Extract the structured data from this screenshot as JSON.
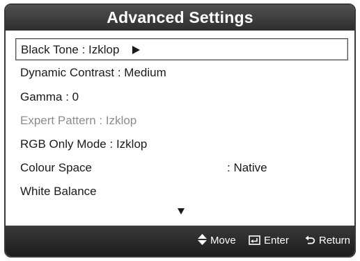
{
  "title": "Advanced Settings",
  "menu": {
    "items": [
      {
        "label": "Black Tone",
        "value": ": Izklop"
      },
      {
        "label": "Dynamic Contrast",
        "value": ": Medium"
      },
      {
        "label": "Gamma",
        "value": ": 0"
      },
      {
        "label": "Expert Pattern",
        "value": ": Izklop"
      },
      {
        "label": "RGB Only Mode",
        "value": ": Izklop"
      },
      {
        "label": "Colour Space",
        "value": ": Native"
      },
      {
        "label": "White Balance"
      }
    ]
  },
  "footer": {
    "move_label": "Move",
    "enter_label": "Enter",
    "return_label": "Return"
  },
  "icons": {
    "submenu": "play-arrow-icon",
    "scroll": "scroll-down-arrow-icon",
    "move": "up-down-arrows-icon",
    "enter": "enter-icon",
    "return": "return-icon"
  },
  "colors": {
    "header_bg": "#3a3a3a",
    "footer_bg": "#262626",
    "disabled_text": "#8c8c8c"
  }
}
